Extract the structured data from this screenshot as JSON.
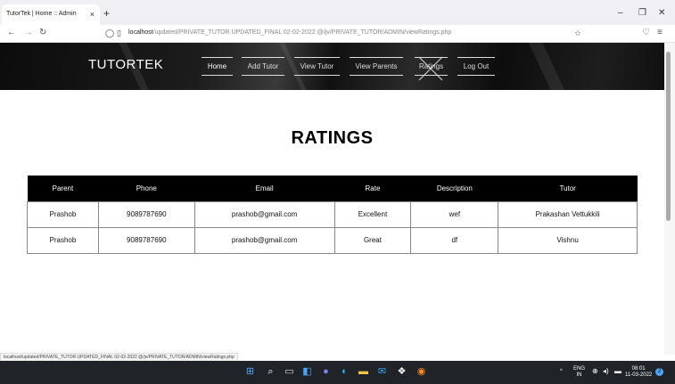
{
  "browser": {
    "tab_title": "TutorTek | Home :: Admin",
    "tab_close": "×",
    "new_tab": "+",
    "minimize": "–",
    "restore": "❐",
    "close": "✕",
    "url_host": "localhost",
    "url_path": "/updated/PRIVATE_TUTOR UPDATED_FINAL 02-02-2022 @/jv/PRIVATE_TUTOR/ADMIN/viewRatings.php",
    "status_url": "localhost/updated/PRIVATE_TUTOR UPDATED_FINAL 02-02-2022 @/jv/PRIVATE_TUTOR/ADMIN/viewRatings.php"
  },
  "site": {
    "brand": "TUTORTEK",
    "nav": [
      {
        "label": "Home"
      },
      {
        "label": "Add Tutor"
      },
      {
        "label": "View Tutor"
      },
      {
        "label": "View Parents"
      },
      {
        "label": "Ratings"
      },
      {
        "label": "Log Out"
      }
    ]
  },
  "main": {
    "title": "RATINGS",
    "columns": [
      "Parent",
      "Phone",
      "Email",
      "Rate",
      "Description",
      "Tutor"
    ],
    "rows": [
      [
        "Prashob",
        "9089787690",
        "prashob@gmail.com",
        "Excellent",
        "wef",
        "Prakashan Vettukkili"
      ],
      [
        "Prashob",
        "9089787690",
        "prashob@gmail.com",
        "Great",
        "df",
        "Vishnu"
      ]
    ]
  },
  "taskbar": {
    "lang_top": "ENG",
    "lang_bottom": "IN",
    "time": "08:01",
    "date": "11-03-2022",
    "notification_count": "2"
  },
  "colors": {
    "header_bg": "#111111",
    "table_header_bg": "#000000",
    "taskbar_bg": "#202428"
  }
}
